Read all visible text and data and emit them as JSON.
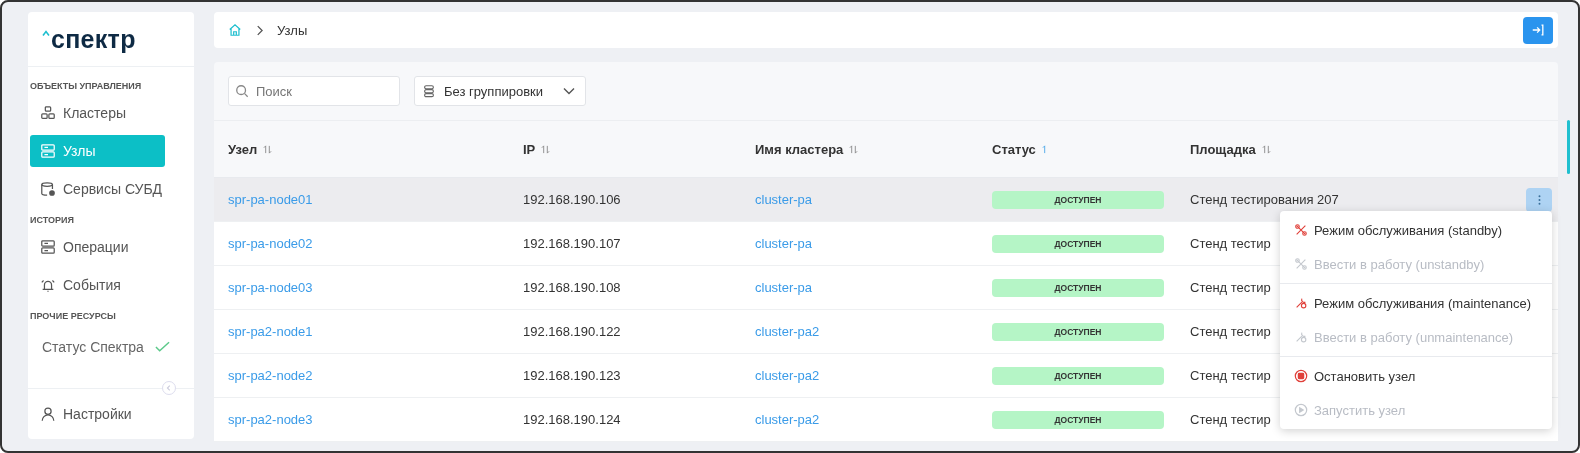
{
  "logo": "спектр",
  "sidebar": {
    "sections": [
      {
        "title": "ОБЪЕКТЫ УПРАВЛЕНИЯ",
        "items": [
          {
            "label": "Кластеры",
            "selected": false
          },
          {
            "label": "Узлы",
            "selected": true
          },
          {
            "label": "Сервисы СУБД",
            "selected": false
          }
        ]
      },
      {
        "title": "ИСТОРИЯ",
        "items": [
          {
            "label": "Операции",
            "selected": false
          },
          {
            "label": "События",
            "selected": false
          }
        ]
      },
      {
        "title": "ПРОЧИЕ РЕСУРСЫ",
        "items": [
          {
            "label": "Статус Спектра",
            "selected": false
          }
        ]
      }
    ],
    "footer": {
      "label": "Настройки"
    }
  },
  "breadcrumb": [
    "Узлы"
  ],
  "search": {
    "placeholder": "Поиск"
  },
  "grouping": {
    "value": "Без группировки"
  },
  "table": {
    "columns": [
      {
        "label": "Узел",
        "sorted": false
      },
      {
        "label": "IP",
        "sorted": false
      },
      {
        "label": "Имя кластера",
        "sorted": false
      },
      {
        "label": "Статус",
        "sorted": true
      },
      {
        "label": "Площадка",
        "sorted": false
      }
    ],
    "rows": [
      {
        "node": "spr-pa-node01",
        "ip": "192.168.190.106",
        "cluster": "cluster-pa",
        "status": "ДОСТУПЕН",
        "site": "Стенд тестирования 207",
        "selected": true
      },
      {
        "node": "spr-pa-node02",
        "ip": "192.168.190.107",
        "cluster": "cluster-pa",
        "status": "ДОСТУПЕН",
        "site": "Стенд тестир",
        "selected": false
      },
      {
        "node": "spr-pa-node03",
        "ip": "192.168.190.108",
        "cluster": "cluster-pa",
        "status": "ДОСТУПЕН",
        "site": "Стенд тестир",
        "selected": false
      },
      {
        "node": "spr-pa2-node1",
        "ip": "192.168.190.122",
        "cluster": "cluster-pa2",
        "status": "ДОСТУПЕН",
        "site": "Стенд тестир",
        "selected": false
      },
      {
        "node": "spr-pa2-node2",
        "ip": "192.168.190.123",
        "cluster": "cluster-pa2",
        "status": "ДОСТУПЕН",
        "site": "Стенд тестир",
        "selected": false
      },
      {
        "node": "spr-pa2-node3",
        "ip": "192.168.190.124",
        "cluster": "cluster-pa2",
        "status": "ДОСТУПЕН",
        "site": "Стенд тестир",
        "selected": false
      }
    ]
  },
  "context_menu": {
    "groups": [
      [
        {
          "label": "Режим обслуживания (standby)",
          "kind": "standby",
          "disabled": false
        },
        {
          "label": "Ввести в работу (unstandby)",
          "kind": "standby",
          "disabled": true
        }
      ],
      [
        {
          "label": "Режим обслуживания (maintenance)",
          "kind": "maintenance",
          "disabled": false
        },
        {
          "label": "Ввести в работу (unmaintenance)",
          "kind": "maintenance",
          "disabled": true
        }
      ],
      [
        {
          "label": "Остановить узел",
          "kind": "stop",
          "disabled": false
        },
        {
          "label": "Запустить узел",
          "kind": "start",
          "disabled": true
        }
      ]
    ]
  }
}
